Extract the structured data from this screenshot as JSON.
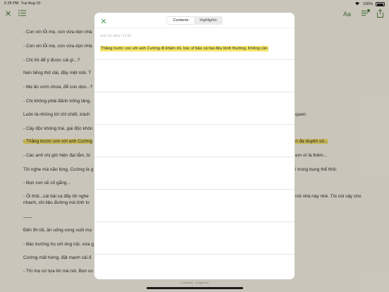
{
  "status": {
    "time": "5:25 PM",
    "date": "Tue Aug 10",
    "battery": "100%"
  },
  "toolbar": {
    "close_icon": "close-icon",
    "toc_icon": "list-icon",
    "font_icon": "Aa",
    "highlights_icon": "highlights-icon",
    "share_icon": "share-icon"
  },
  "reader": {
    "lines": [
      "- Con xin lỗi mẹ, con vừa dọn nhà",
      "- Chị thì để ý được cái gì...?",
      "Nén tiếng thở dài, đầy mệt mỏi. T",
      "- Mẹ ăn cơm chưa, để con dọn...?",
      "- Chị không phải đánh trống lảng,",
      "Luôn là những lời chỉ chiết, trách",
      "- Cây độc không trái, gái độc khôn",
      "- Thằng trước con với anh Cường",
      "- Các anh chị giờ hiện đại lắm, bi",
      "Tôi nghe mà não lòng, Cường là g",
      "- Bọn con sẽ cố gắng...",
      "- Ôi thôi...cái bài ca đấy tôi nghe",
      "nhanh, chị liệu đường mà tính to",
      "Đến 9h tối, ăn uống xong xuôi mọ",
      "- Bác trưởng họ với ông nội, vừa g",
      "Cường mất hứng, đặt mạnh cái đ",
      "- Thì mẹ cứ lựa lời mà nói. Bọn co"
    ],
    "right_fragments": {
      "quen": "quen:",
      "duyen": "n đa duyên số...",
      "em": "em ơi là thêm...",
      "trong": "i trong bụng thể thôi:",
      "noi": "nói nhà này nhé. Tôi nói vậy cho"
    },
    "separator": "——"
  },
  "modal": {
    "tabs": [
      "Contents",
      "Highlights"
    ],
    "active_tab": "Contents",
    "entry": {
      "date": "AUG 10, 2021 / 17:25",
      "text": "Thằng trước con với anh Cường đi khám rồi, bác sĩ bảo cả hai đều bình thường. Không cần"
    }
  },
  "footer": {
    "time_left": "2 minutes",
    "pages_left": "1 page left"
  },
  "colors": {
    "accent": "#4b9a55",
    "highlight": "#f6e76a",
    "paper": "#f6f1e3"
  }
}
